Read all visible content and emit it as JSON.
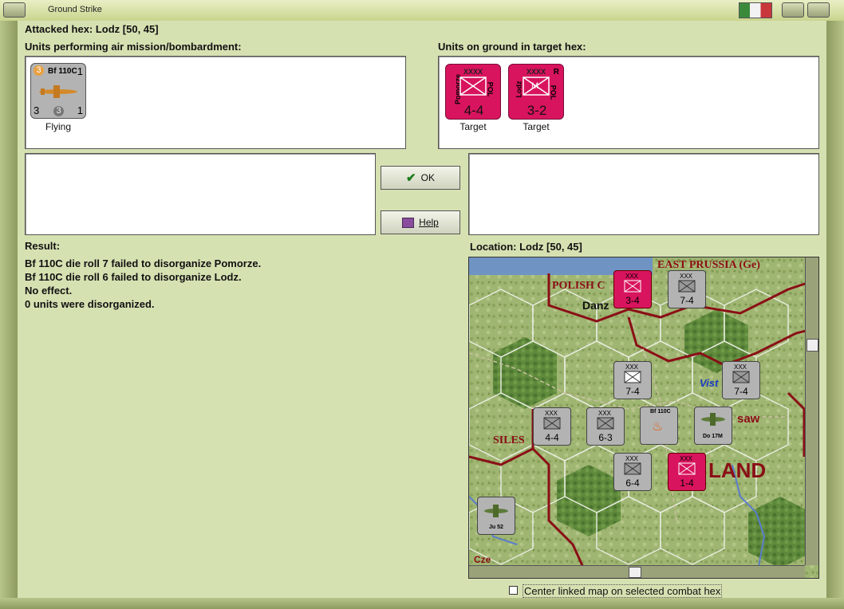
{
  "window": {
    "title": "Ground Strike"
  },
  "header": {
    "attacked_hex": "Attacked hex: Lodz  [50, 45]"
  },
  "air_units": {
    "label": "Units performing air mission/bombardment:",
    "items": [
      {
        "name": "Bf 110C",
        "top_left": "3",
        "top_right": "1",
        "bottom_left": "3",
        "bottom_mid": "3",
        "bottom_right": "1",
        "status": "Flying"
      }
    ]
  },
  "ground_units": {
    "label": "Units on ground in target hex:",
    "items": [
      {
        "name": "Pomorze",
        "size": "XXXX",
        "nation": "POL",
        "strength": "4-4",
        "status": "Target"
      },
      {
        "name": "Lodz",
        "size": "XXXX",
        "nation": "POL",
        "flag": "R",
        "symbol": "M",
        "strength": "3-2",
        "status": "Target"
      }
    ]
  },
  "buttons": {
    "ok": "OK",
    "help": "Help"
  },
  "result": {
    "label": "Result:",
    "lines": [
      "Bf 110C die roll 7 failed to disorganize Pomorze.",
      "Bf 110C die roll 6 failed to disorganize Lodz.",
      "No effect.",
      "0 units were disorganized."
    ]
  },
  "location": {
    "label": "Location:  Lodz  [50, 45]"
  },
  "map": {
    "labels": [
      "EAST PRUSSIA (Ge)",
      "POLISH C",
      "Danz",
      "Vist",
      "saw",
      "SILES",
      "LAND",
      "Cze"
    ],
    "counters": [
      {
        "top": "XXX",
        "strength": "3-4",
        "color": "red"
      },
      {
        "top": "XXX",
        "strength": "7-4",
        "color": "gray"
      },
      {
        "top": "XXX",
        "strength": "7-4",
        "color": "gray"
      },
      {
        "top": "XXX",
        "strength": "7-4",
        "color": "gray"
      },
      {
        "top": "XXX",
        "strength": "4-4",
        "color": "gray"
      },
      {
        "top": "XXX",
        "strength": "6-3",
        "color": "gray"
      },
      {
        "top": "XXX",
        "strength": "6-4",
        "color": "gray"
      },
      {
        "top": "XXX",
        "strength": "1-4",
        "color": "red"
      }
    ],
    "air": [
      {
        "name": "Bf 110C"
      },
      {
        "name": "Do 17M"
      },
      {
        "name": "Ju 52"
      }
    ]
  },
  "checkbox": {
    "label": "Center linked map on selected combat hex",
    "checked": false
  },
  "colors": {
    "accent_red": "#d8145e",
    "panel_bg": "#d6e1b2"
  }
}
